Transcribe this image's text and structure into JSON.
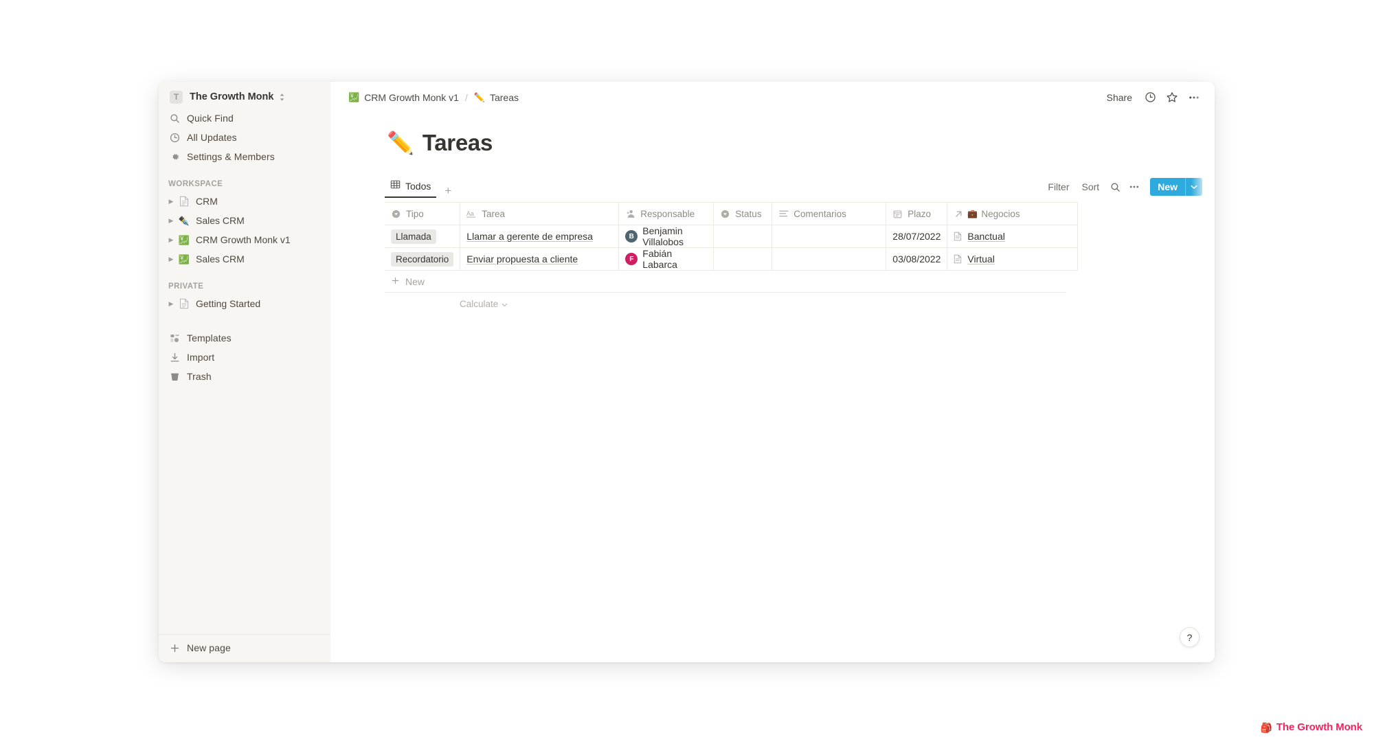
{
  "window": {
    "sidebar": {
      "workspace": {
        "avatar_letter": "T",
        "name": "The Growth Monk",
        "switcher_icon": "chevron-up-down-icon"
      },
      "nav": [
        {
          "icon": "search-icon",
          "label": "Quick Find"
        },
        {
          "icon": "clock-icon",
          "label": "All Updates"
        },
        {
          "icon": "gear-icon",
          "label": "Settings & Members"
        }
      ],
      "workspace_section": {
        "title": "WORKSPACE",
        "pages": [
          {
            "icon": "document-icon",
            "label": "CRM"
          },
          {
            "icon": "pen-emoji",
            "label": "Sales CRM"
          },
          {
            "icon": "chart-increasing-yen-emoji",
            "label": "CRM Growth Monk v1"
          },
          {
            "icon": "chart-increasing-yen-emoji",
            "label": "Sales CRM"
          }
        ]
      },
      "private_section": {
        "title": "PRIVATE",
        "pages": [
          {
            "icon": "document-icon",
            "label": "Getting Started"
          }
        ]
      },
      "tools": [
        {
          "icon": "templates-icon",
          "label": "Templates"
        },
        {
          "icon": "import-icon",
          "label": "Import"
        },
        {
          "icon": "trash-icon",
          "label": "Trash"
        }
      ],
      "footer": {
        "icon": "plus-icon",
        "label": "New page"
      }
    },
    "topbar": {
      "breadcrumb": [
        {
          "icon": "chart-increasing-yen-emoji",
          "label": "CRM Growth Monk v1"
        },
        {
          "icon": "pencil-emoji",
          "label": "Tareas"
        }
      ],
      "separator": "/",
      "share_label": "Share",
      "icons": [
        {
          "name": "updates-clock-icon"
        },
        {
          "name": "favorite-star-icon"
        },
        {
          "name": "more-options-icon"
        }
      ]
    },
    "page": {
      "emoji": "✏️",
      "title": "Tareas"
    },
    "view_bar": {
      "tabs": [
        {
          "icon": "table-icon",
          "label": "Todos",
          "active": true
        }
      ],
      "add_view_icon": "plus-icon",
      "filter_label": "Filter",
      "sort_label": "Sort",
      "search_icon": "search-icon",
      "more_icon": "more-options-icon",
      "new_label": "New",
      "new_chevron_icon": "chevron-down-icon",
      "accent_color": "#2eaadc"
    },
    "table": {
      "columns": [
        {
          "icon": "select-icon",
          "label": "Tipo"
        },
        {
          "icon": "title-aa-icon",
          "label": "Tarea"
        },
        {
          "icon": "person-icon",
          "label": "Responsable"
        },
        {
          "icon": "select-icon",
          "label": "Status"
        },
        {
          "icon": "text-lines-icon",
          "label": "Comentarios"
        },
        {
          "icon": "calendar-icon",
          "label": "Plazo"
        },
        {
          "icon": "relation-arrow-icon",
          "emoji": "💼",
          "label": "Negocios"
        }
      ],
      "rows": [
        {
          "tipo": "Llamada",
          "tarea": "Llamar a gerente de empresa",
          "responsable": {
            "initial": "B",
            "name": "Benjamin Villalobos",
            "color": "#4f6570"
          },
          "status": "",
          "comentarios": "",
          "plazo": "28/07/2022",
          "negocios": "Banctual"
        },
        {
          "tipo": "Recordatorio",
          "tarea": "Enviar propuesta a cliente",
          "responsable": {
            "initial": "F",
            "name": "Fabián Labarca",
            "color": "#d01e63"
          },
          "status": "",
          "comentarios": "",
          "plazo": "03/08/2022",
          "negocios": "Virtual"
        }
      ],
      "new_row_label": "New",
      "new_row_icon": "plus-icon",
      "calculate_label": "Calculate",
      "calculate_chevron_icon": "chevron-down-icon"
    },
    "help_button": {
      "label": "?"
    }
  },
  "watermark": {
    "icon": "🎒",
    "label": "The Growth Monk",
    "color": "#f4245e"
  }
}
